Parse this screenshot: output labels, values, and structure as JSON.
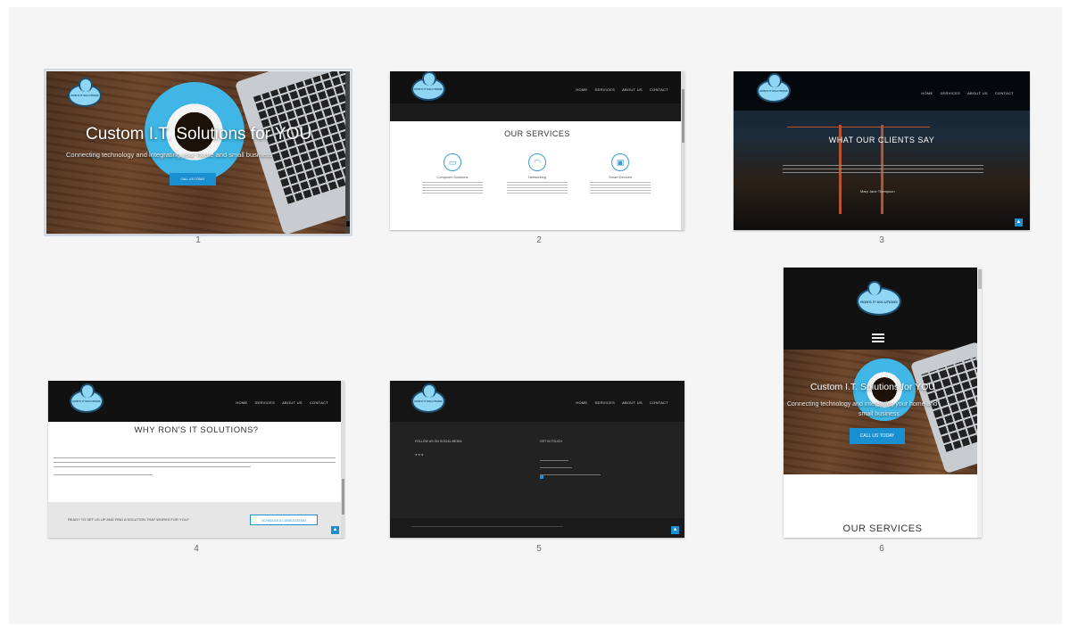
{
  "captions": [
    "1",
    "2",
    "3",
    "4",
    "5",
    "6"
  ],
  "nav_links": [
    "HOME",
    "SERVICES",
    "ABOUT US",
    "CONTACT"
  ],
  "logo_text": "RON'S IT SOLUTIONS",
  "hero": {
    "title": "Custom I.T. Solutions for YOU",
    "subtitle": "Connecting technology and integrating your home and small business",
    "cta": "CALL US TODAY"
  },
  "services": {
    "heading": "OUR SERVICES",
    "items": [
      {
        "name": "Computer Solutions",
        "icon": "monitor-icon"
      },
      {
        "name": "Networking",
        "icon": "wifi-icon"
      },
      {
        "name": "Smart Devices",
        "icon": "devices-icon"
      }
    ]
  },
  "testimonial": {
    "heading": "WHAT OUR CLIENTS SAY",
    "author": "Mary Jane Thompson"
  },
  "why": {
    "heading": "WHY RON'S IT SOLUTIONS?",
    "cta_text": "READY TO SET US UP AND FIND A SOLUTION THAT WORKS FOR YOU?",
    "cta_button": "SCHEDULE A CONSULTATION"
  },
  "footer": {
    "follow": "FOLLOW US ON SOCIAL MEDIA",
    "contact": "GET IN TOUCH"
  },
  "mobile": {
    "hero_title": "Custom I.T. Solutions for YOU",
    "hero_sub_1": "Connecting technology and integrating your home and",
    "hero_sub_2": "small business",
    "cta": "CALL US TODAY",
    "services_heading": "OUR SERVICES",
    "menu_icon": "hamburger-icon"
  },
  "colors": {
    "accent": "#1a8fd1",
    "cup": "#3fb6e6",
    "nav": "#111111"
  }
}
